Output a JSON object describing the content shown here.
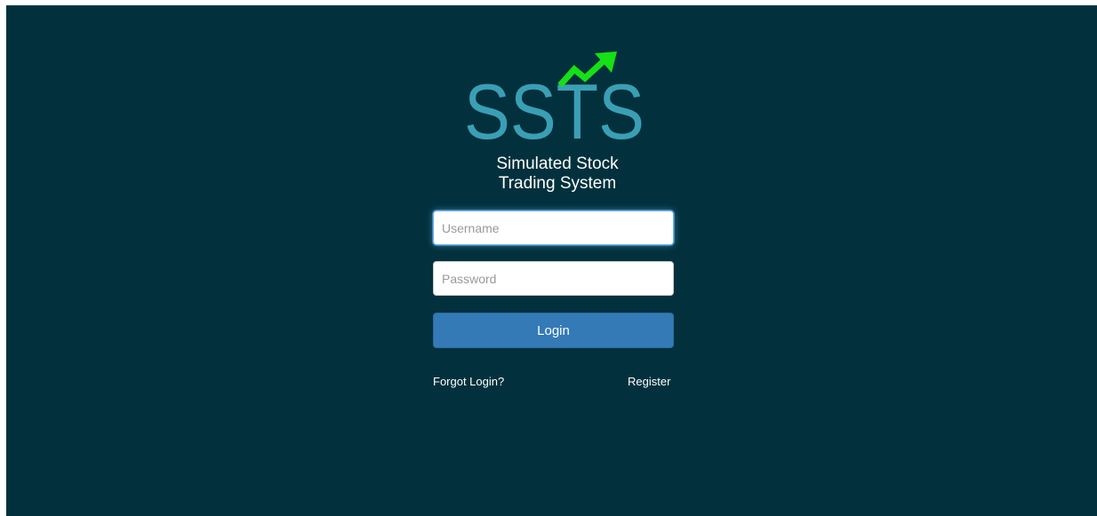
{
  "logo": {
    "letters": "SSTS",
    "icon": "trending-up-arrow-icon",
    "letter_color": "#3a9fb5",
    "arrow_color": "#16e016"
  },
  "subtitle": {
    "line1": "Simulated Stock",
    "line2": "Trading System"
  },
  "form": {
    "username_placeholder": "Username",
    "username_value": "",
    "password_placeholder": "Password",
    "password_value": "",
    "login_label": "Login"
  },
  "links": {
    "forgot": "Forgot Login?",
    "register": "Register"
  },
  "colors": {
    "background": "#02313d",
    "button": "#337ab7",
    "text": "#ffffff"
  }
}
